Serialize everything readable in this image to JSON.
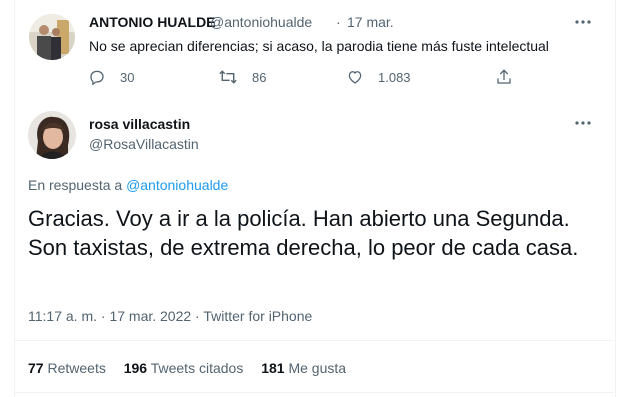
{
  "reply": {
    "author_name": "ANTONIO HUALDE",
    "author_handle": "@antoniohualde",
    "separator": "·",
    "date": "17 mar.",
    "text": "No se aprecian diferencias; si acaso, la parodia tiene más fuste intelectual",
    "replies": "30",
    "retweets": "86",
    "likes": "1.083"
  },
  "main": {
    "author_name": "rosa villacastin",
    "author_handle": "@RosaVillacastin",
    "in_reply_prefix": "En respuesta a",
    "in_reply_handle": "@antoniohualde",
    "text": "Gracias. Voy a ir a la policía. Han abierto una Segunda. Son taxistas, de extrema derecha, lo peor de cada casa.",
    "timestamp": "11:17 a. m. · 17 mar. 2022 · Twitter for iPhone"
  },
  "stats": {
    "retweets_count": "77",
    "retweets_label": "Retweets",
    "quotes_count": "196",
    "quotes_label": "Tweets citados",
    "likes_count": "181",
    "likes_label": "Me gusta"
  },
  "colors": {
    "link": "#1d9bf0",
    "muted": "#536471",
    "text": "#0f1419"
  }
}
